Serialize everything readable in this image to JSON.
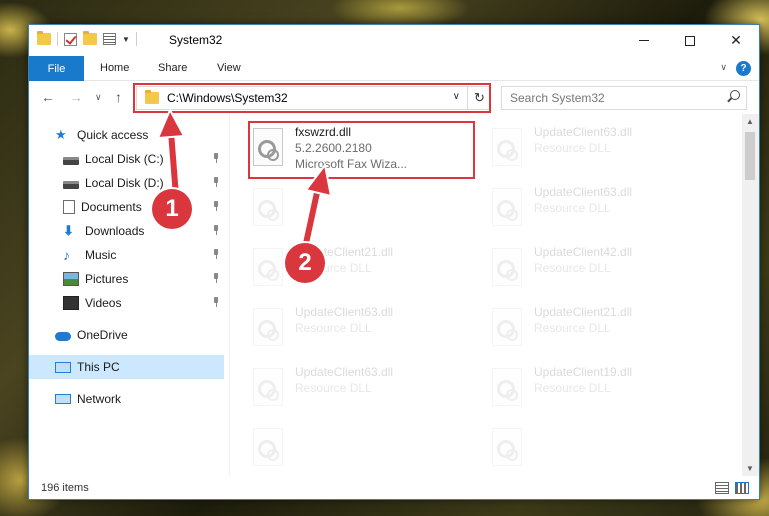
{
  "window": {
    "title": "System32"
  },
  "ribbon": {
    "file": "File",
    "tabs": [
      "Home",
      "Share",
      "View"
    ],
    "help": "?"
  },
  "address": {
    "path": "C:\\Windows\\System32",
    "search_placeholder": "Search System32"
  },
  "sidebar": {
    "quick_access": "Quick access",
    "items": [
      {
        "label": "Local Disk (C:)",
        "icon": "drive-icon"
      },
      {
        "label": "Local Disk (D:)",
        "icon": "drive-icon"
      },
      {
        "label": "Documents",
        "icon": "documents-icon"
      },
      {
        "label": "Downloads",
        "icon": "downloads-icon"
      },
      {
        "label": "Music",
        "icon": "music-icon"
      },
      {
        "label": "Pictures",
        "icon": "pictures-icon"
      },
      {
        "label": "Videos",
        "icon": "videos-icon"
      }
    ],
    "onedrive": "OneDrive",
    "this_pc": "This PC",
    "network": "Network"
  },
  "files": {
    "highlighted": {
      "name": "fxswzrd.dll",
      "version": "5.2.2600.2180",
      "desc": "Microsoft  Fax Wiza..."
    },
    "faded": [
      {
        "name": "UpdateClient63.dll",
        "desc": "Resource DLL"
      },
      {
        "name": "UpdateClient63.dll",
        "desc": "Resource DLL"
      },
      {
        "name": "UpdateClient21.dll",
        "desc": "Resource DLL"
      },
      {
        "name": "UpdateClient42.dll",
        "desc": "Resource DLL"
      },
      {
        "name": "UpdateClient63.dll",
        "desc": "Resource DLL"
      },
      {
        "name": "UpdateClient21.dll",
        "desc": "Resource DLL"
      },
      {
        "name": "UpdateClient63.dll",
        "desc": "Resource DLL"
      },
      {
        "name": "UpdateClient19.dll",
        "desc": "Resource DLL"
      }
    ]
  },
  "status": {
    "count": "196 items"
  },
  "annotations": {
    "step1": "1",
    "step2": "2",
    "color": "#d9363e"
  }
}
